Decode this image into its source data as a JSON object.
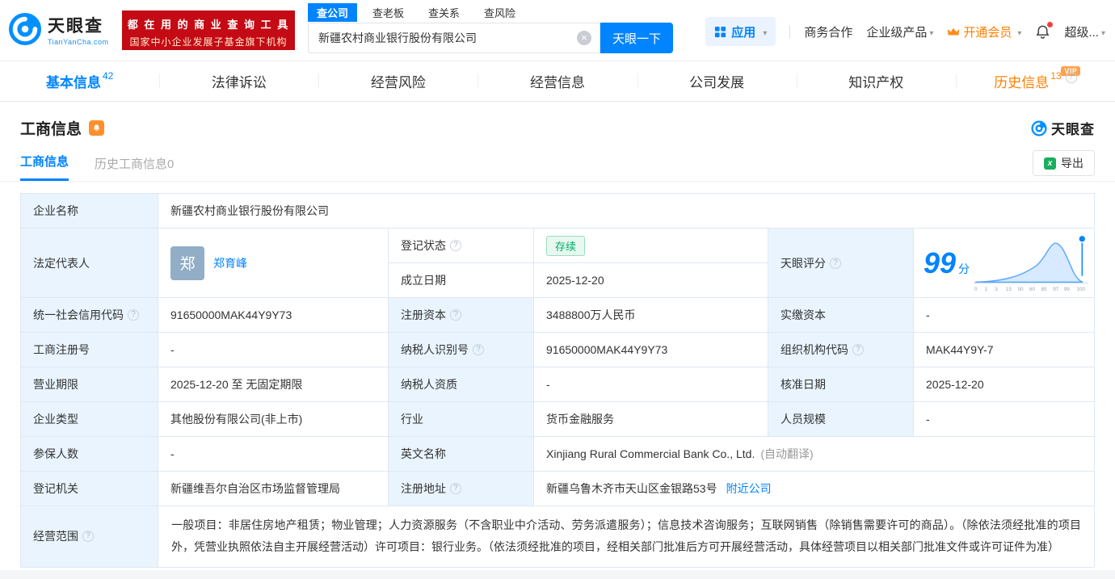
{
  "brand": {
    "name": "天眼查",
    "domain": "TianYanCha.com"
  },
  "promo": {
    "line1": "都 在 用 的 商 业 查 询 工 具",
    "line2": "国家中小企业发展子基金旗下机构"
  },
  "search": {
    "tab_company": "查公司",
    "tab_boss": "查老板",
    "tab_relation": "查关系",
    "tab_risk": "查风险",
    "value": "新疆农村商业银行股份有限公司",
    "button": "天眼一下"
  },
  "topnav": {
    "apps": "应用",
    "cooperation": "商务合作",
    "enterprise": "企业级产品",
    "vip": "开通会员",
    "super": "超级..."
  },
  "tabs": {
    "t1": {
      "label": "基本信息",
      "count": "42"
    },
    "t2": {
      "label": "法律诉讼"
    },
    "t3": {
      "label": "经营风险"
    },
    "t4": {
      "label": "经营信息"
    },
    "t5": {
      "label": "公司发展"
    },
    "t6": {
      "label": "知识产权"
    },
    "t7": {
      "label": "历史信息",
      "count": "13",
      "vip": "VIP"
    }
  },
  "section": {
    "title": "工商信息",
    "brand": "天眼查",
    "subtab_active": "工商信息",
    "subtab_history": "历史工商信息0",
    "export": "导出"
  },
  "fields": {
    "company_name": {
      "label": "企业名称",
      "value": "新疆农村商业银行股份有限公司"
    },
    "legal_rep": {
      "label": "法定代表人",
      "avatar": "郑",
      "value": "郑育峰"
    },
    "reg_status": {
      "label": "登记状态",
      "value": "存续"
    },
    "establish_date": {
      "label": "成立日期",
      "value": "2025-12-20"
    },
    "score": {
      "label": "天眼评分",
      "value": "99",
      "unit": "分"
    },
    "credit_code": {
      "label": "统一社会信用代码",
      "value": "91650000MAK44Y9Y73"
    },
    "reg_capital": {
      "label": "注册资本",
      "value": "3488800万人民币"
    },
    "paid_capital": {
      "label": "实缴资本",
      "value": "-"
    },
    "reg_number": {
      "label": "工商注册号",
      "value": "-"
    },
    "taxpayer_id": {
      "label": "纳税人识别号",
      "value": "91650000MAK44Y9Y73"
    },
    "org_code": {
      "label": "组织机构代码",
      "value": "MAK44Y9Y-7"
    },
    "term": {
      "label": "营业期限",
      "value": "2025-12-20 至 无固定期限"
    },
    "taxpayer_qual": {
      "label": "纳税人资质",
      "value": "-"
    },
    "approval_date": {
      "label": "核准日期",
      "value": "2025-12-20"
    },
    "company_type": {
      "label": "企业类型",
      "value": "其他股份有限公司(非上市)"
    },
    "industry": {
      "label": "行业",
      "value": "货币金融服务"
    },
    "staff": {
      "label": "人员规模",
      "value": "-"
    },
    "insured": {
      "label": "参保人数",
      "value": "-"
    },
    "english_name": {
      "label": "英文名称",
      "value": "Xinjiang Rural Commercial Bank Co., Ltd.",
      "note": "(自动翻译)"
    },
    "authority": {
      "label": "登记机关",
      "value": "新疆维吾尔自治区市场监督管理局"
    },
    "address": {
      "label": "注册地址",
      "value": "新疆乌鲁木齐市天山区金银路53号",
      "link": "附近公司"
    },
    "scope": {
      "label": "经营范围",
      "value": "一般项目：非居住房地产租赁；物业管理；人力资源服务（不含职业中介活动、劳务派遣服务）；信息技术咨询服务；互联网销售（除销售需要许可的商品）。（除依法须经批准的项目外，凭营业执照依法自主开展经营活动）许可项目：银行业务。（依法须经批准的项目，经相关部门批准后方可开展经营活动，具体经营项目以相关部门批准文件或许可证件为准）"
    }
  },
  "chart_data": {
    "type": "area",
    "title": "天眼评分",
    "score": 99,
    "x_labels": [
      "0",
      "1",
      "3",
      "15",
      "50",
      "60",
      "85",
      "97",
      "99",
      "100"
    ],
    "marker_at": "99"
  },
  "colors": {
    "accent": "#0084ff",
    "orange": "#ff8000",
    "red_banner": "#c40a14",
    "green": "#00ad66",
    "label_bg": "#e9f4fe"
  }
}
